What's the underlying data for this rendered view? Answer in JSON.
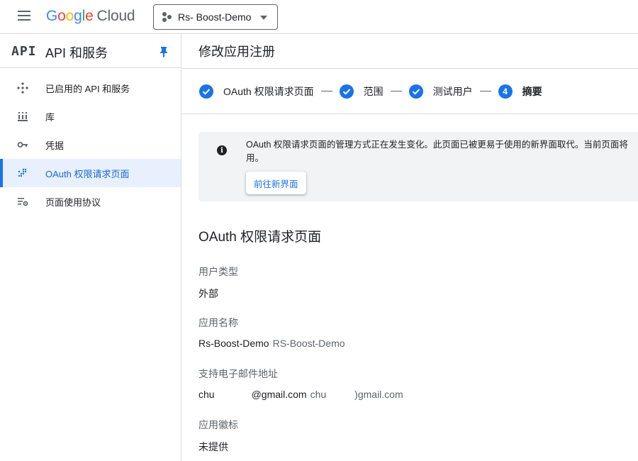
{
  "header": {
    "logo": {
      "g1": "G",
      "o1": "o",
      "o2": "o",
      "g2": "g",
      "l": "l",
      "e": "e",
      "cloud": "Cloud"
    },
    "project_name": "Rs- Boost-Demo"
  },
  "sidebar": {
    "api_mark": "API",
    "title": "API 和服务",
    "items": [
      {
        "label": "已启用的 API 和服务",
        "icon": "enabled-apis-icon"
      },
      {
        "label": "库",
        "icon": "library-icon"
      },
      {
        "label": "凭据",
        "icon": "key-icon"
      },
      {
        "label": "OAuth 权限请求页面",
        "icon": "oauth-consent-icon",
        "active": true
      },
      {
        "label": "页面使用协议",
        "icon": "page-usage-icon"
      }
    ]
  },
  "main": {
    "title": "修改应用注册",
    "steps": [
      {
        "label": "OAuth 权限请求页面",
        "state": "done"
      },
      {
        "label": "范围",
        "state": "done"
      },
      {
        "label": "测试用户",
        "state": "done"
      },
      {
        "number": "4",
        "label": "摘要",
        "state": "current"
      }
    ],
    "banner": {
      "text": "OAuth 权限请求页面的管理方式正在发生变化。此页面已被更易于使用的新界面取代。当前页面将",
      "text_line2": "用。",
      "button": "前往新界面"
    },
    "section_title": "OAuth 权限请求页面",
    "fields": [
      {
        "label": "用户类型",
        "value": "外部"
      },
      {
        "label": "应用名称",
        "value": "Rs-Boost-Demo",
        "value2": "RS-Boost-Demo"
      },
      {
        "label": "支持电子邮件地址",
        "value_prefix": "chu",
        "value_suffix": "@gmail.com",
        "value2_prefix": "chu",
        "value2_suffix": ")gmail.com"
      },
      {
        "label": "应用徽标",
        "value": "未提供"
      }
    ]
  },
  "colors": {
    "accent": "#1a73e8",
    "active_bg": "#e8f0fe",
    "banner_bg": "#f1f3f4"
  }
}
